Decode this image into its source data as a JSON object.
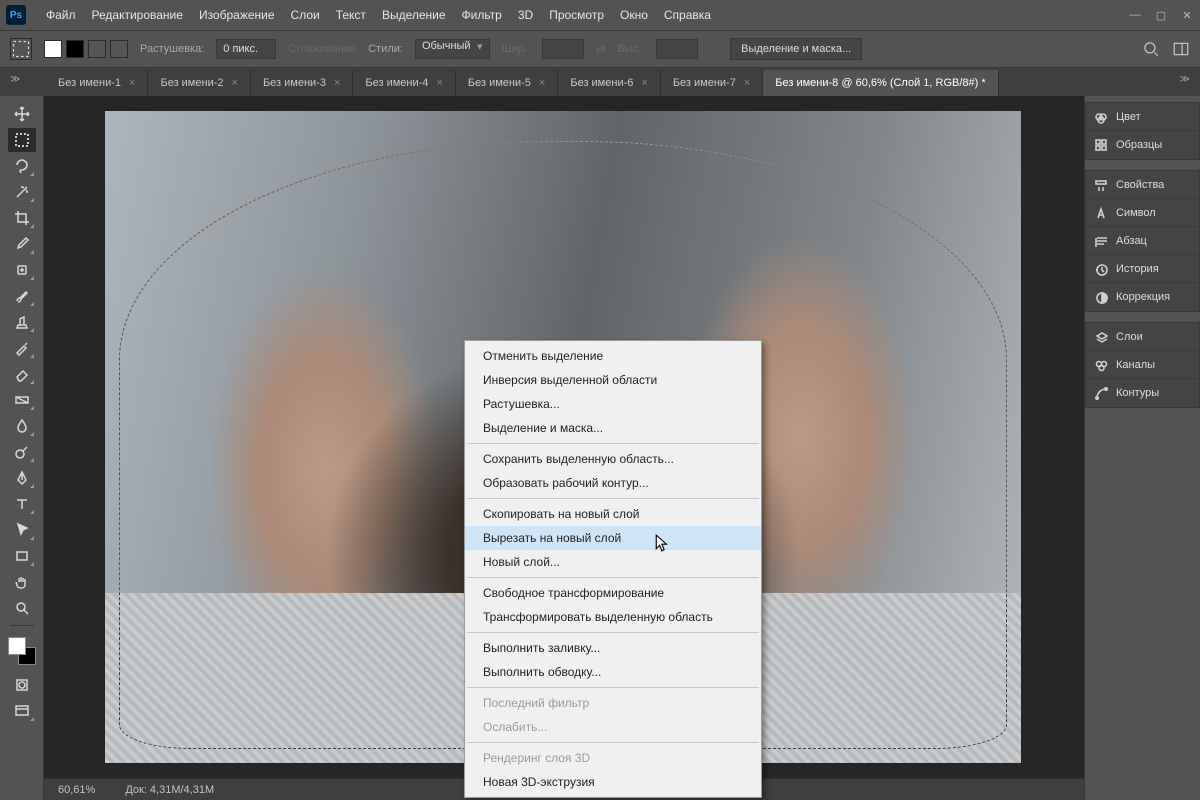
{
  "menubar": {
    "items": [
      "Файл",
      "Редактирование",
      "Изображение",
      "Слои",
      "Текст",
      "Выделение",
      "Фильтр",
      "3D",
      "Просмотр",
      "Окно",
      "Справка"
    ]
  },
  "optbar": {
    "feather_label": "Растушевка:",
    "feather_value": "0 пикс.",
    "antialias": "Сглаживание",
    "style_label": "Стили:",
    "style_value": "Обычный",
    "width_label": "Шир.:",
    "height_label": "Выс.:",
    "select_mask_btn": "Выделение и маска..."
  },
  "tabs": {
    "inactive": [
      "Без имени-1",
      "Без имени-2",
      "Без имени-3",
      "Без имени-4",
      "Без имени-5",
      "Без имени-6",
      "Без имени-7"
    ],
    "active": "Без имени-8 @ 60,6% (Слой 1, RGB/8#) *"
  },
  "panels": {
    "g1": [
      "Цвет",
      "Образцы"
    ],
    "g2": [
      "Свойства",
      "Символ",
      "Абзац",
      "История",
      "Коррекция"
    ],
    "g3": [
      "Слои",
      "Каналы",
      "Контуры"
    ]
  },
  "context_menu": {
    "items": [
      {
        "t": "Отменить выделение"
      },
      {
        "t": "Инверсия выделенной области"
      },
      {
        "t": "Растушевка..."
      },
      {
        "t": "Выделение и маска..."
      },
      {
        "sep": true
      },
      {
        "t": "Сохранить выделенную область..."
      },
      {
        "t": "Образовать рабочий контур..."
      },
      {
        "sep": true
      },
      {
        "t": "Скопировать на новый слой"
      },
      {
        "t": "Вырезать на новый слой",
        "hl": true
      },
      {
        "t": "Новый слой..."
      },
      {
        "sep": true
      },
      {
        "t": "Свободное трансформирование"
      },
      {
        "t": "Трансформировать выделенную область"
      },
      {
        "sep": true
      },
      {
        "t": "Выполнить заливку..."
      },
      {
        "t": "Выполнить обводку..."
      },
      {
        "sep": true
      },
      {
        "t": "Последний фильтр",
        "dis": true
      },
      {
        "t": "Ослабить...",
        "dis": true
      },
      {
        "sep": true
      },
      {
        "t": "Рендеринг слоя 3D",
        "dis": true
      },
      {
        "t": "Новая 3D-экструзия"
      }
    ]
  },
  "status": {
    "zoom": "60,61%",
    "doc": "Док: 4,31M/4,31M"
  }
}
